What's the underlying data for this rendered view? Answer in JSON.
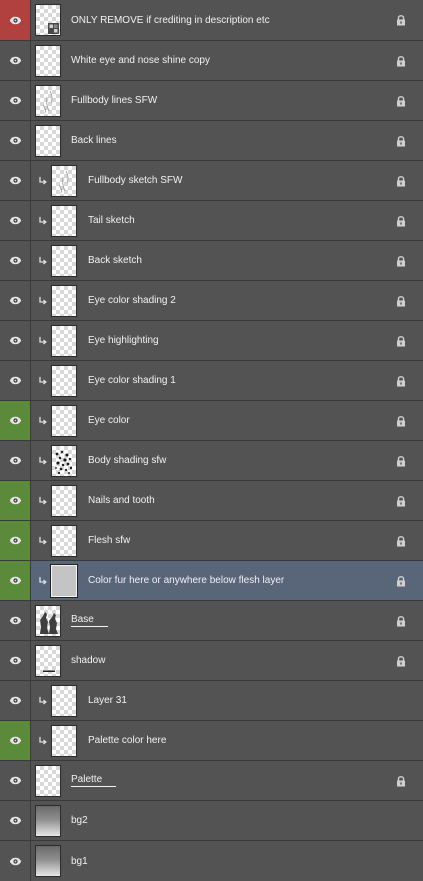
{
  "panel": {
    "layers": [
      {
        "name": "ONLY REMOVE if crediting in description etc",
        "vis": "red",
        "level": 0,
        "thumb": "checker",
        "locked": true,
        "underline": false,
        "selected": false,
        "mark": "mini-icon"
      },
      {
        "name": "White eye and nose shine copy",
        "vis": "none",
        "level": 0,
        "thumb": "checker",
        "locked": true,
        "underline": false,
        "selected": false
      },
      {
        "name": "Fullbody lines SFW",
        "vis": "none",
        "level": 0,
        "thumb": "checker",
        "locked": true,
        "underline": false,
        "selected": false,
        "mark": "lines"
      },
      {
        "name": "Back lines",
        "vis": "none",
        "level": 0,
        "thumb": "checker",
        "locked": true,
        "underline": false,
        "selected": false
      },
      {
        "name": "Fullbody sketch SFW",
        "vis": "none",
        "level": 1,
        "thumb": "checker",
        "locked": true,
        "underline": false,
        "selected": false,
        "mark": "lines"
      },
      {
        "name": "Tail sketch",
        "vis": "none",
        "level": 1,
        "thumb": "checker",
        "locked": true,
        "underline": false,
        "selected": false
      },
      {
        "name": "Back sketch",
        "vis": "none",
        "level": 1,
        "thumb": "checker",
        "locked": true,
        "underline": false,
        "selected": false
      },
      {
        "name": "Eye color shading 2",
        "vis": "none",
        "level": 1,
        "thumb": "checker",
        "locked": true,
        "underline": false,
        "selected": false
      },
      {
        "name": "Eye highlighting",
        "vis": "none",
        "level": 1,
        "thumb": "checker",
        "locked": true,
        "underline": false,
        "selected": false
      },
      {
        "name": "Eye color shading 1",
        "vis": "none",
        "level": 1,
        "thumb": "checker",
        "locked": true,
        "underline": false,
        "selected": false
      },
      {
        "name": "Eye color",
        "vis": "green",
        "level": 1,
        "thumb": "checker",
        "locked": true,
        "underline": false,
        "selected": false
      },
      {
        "name": "Body shading sfw",
        "vis": "none",
        "level": 1,
        "thumb": "checker",
        "locked": true,
        "underline": false,
        "selected": false,
        "mark": "speckle"
      },
      {
        "name": "Nails and tooth",
        "vis": "green",
        "level": 1,
        "thumb": "checker",
        "locked": true,
        "underline": false,
        "selected": false
      },
      {
        "name": "Flesh sfw",
        "vis": "green",
        "level": 1,
        "thumb": "checker",
        "locked": true,
        "underline": false,
        "selected": false
      },
      {
        "name": "Color fur here or anywhere below flesh layer",
        "vis": "green",
        "level": 1,
        "thumb": "gray",
        "locked": true,
        "underline": false,
        "selected": true
      },
      {
        "name": "Base",
        "vis": "none",
        "level": 0,
        "thumb": "checker",
        "locked": true,
        "underline": true,
        "selected": false,
        "mark": "silhouette"
      },
      {
        "name": "shadow",
        "vis": "none",
        "level": 0,
        "thumb": "checker",
        "locked": true,
        "underline": false,
        "selected": false,
        "mark": "dash"
      },
      {
        "name": "Layer 31",
        "vis": "none",
        "level": 1,
        "thumb": "checker",
        "locked": false,
        "underline": false,
        "selected": false
      },
      {
        "name": "Palette color here",
        "vis": "green",
        "level": 1,
        "thumb": "checker",
        "locked": false,
        "underline": false,
        "selected": false
      },
      {
        "name": "Palette",
        "vis": "none",
        "level": 0,
        "thumb": "checker",
        "locked": true,
        "underline": true,
        "selected": false
      },
      {
        "name": "bg2",
        "vis": "none",
        "level": 0,
        "thumb": "gradient",
        "locked": false,
        "underline": false,
        "selected": false
      },
      {
        "name": "bg1",
        "vis": "none",
        "level": 0,
        "thumb": "gradient",
        "locked": false,
        "underline": false,
        "selected": false
      }
    ]
  },
  "icons": {
    "visibility": "eye-icon",
    "clipping": "clipping-mask-arrow-icon",
    "lock": "lock-icon"
  },
  "colors": {
    "panel_bg": "#535353",
    "row_border": "#3a3a3a",
    "selected_row": "#596579",
    "visibility_red": "#b0413e",
    "visibility_green": "#5b8a3b",
    "text": "#f2f2f2"
  }
}
